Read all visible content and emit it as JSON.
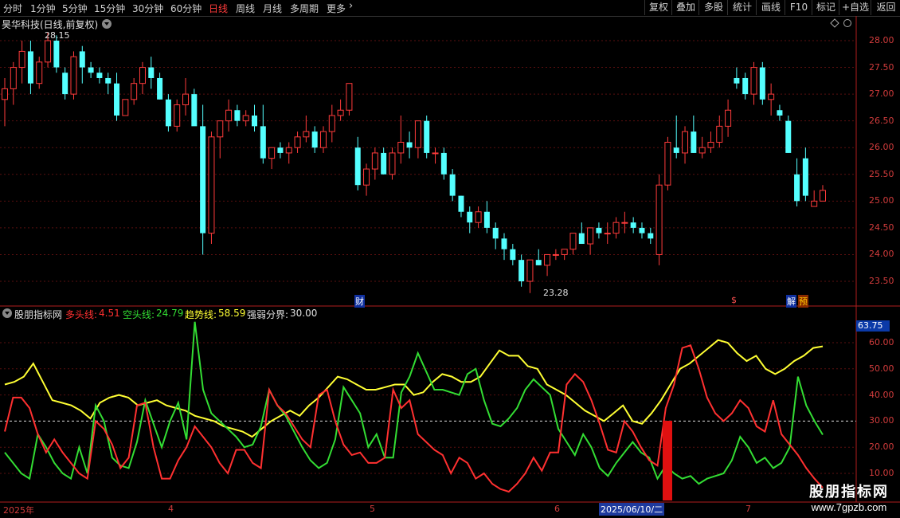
{
  "toolbar": {
    "periods": [
      "分时",
      "1分钟",
      "5分钟",
      "15分钟",
      "30分钟",
      "60分钟",
      "日线",
      "周线",
      "月线",
      "多周期",
      "更多"
    ],
    "active_period": "日线",
    "more_chevron": "›",
    "right_tools": [
      "复权",
      "叠加",
      "多股",
      "统计",
      "画线",
      "F10",
      "标记",
      "+自选",
      "返回"
    ]
  },
  "main_chart": {
    "stock_title": "昊华科技(日线,前复权)",
    "high_marker": "28.15",
    "low_marker": "23.28",
    "y_ticks": [
      "28.00",
      "27.50",
      "27.00",
      "26.50",
      "26.00",
      "25.50",
      "25.00",
      "24.50",
      "24.00",
      "23.50"
    ],
    "event_markers": [
      "财",
      "$",
      "解",
      "预"
    ]
  },
  "indicator": {
    "name": "股朋指标网",
    "lines": [
      {
        "label": "多头线:",
        "value": "4.51",
        "color": "#ff3030"
      },
      {
        "label": "空头线:",
        "value": "24.79",
        "color": "#33dd33"
      },
      {
        "label": "趋势线:",
        "value": "58.59",
        "color": "#ffff33"
      },
      {
        "label": "强弱分界:",
        "value": "30.00",
        "color": "#e0e0e0"
      }
    ],
    "current_value": "63.75",
    "y_ticks": [
      "60.00",
      "50.00",
      "40.00",
      "30.00",
      "20.00",
      "10.00"
    ]
  },
  "date_axis": {
    "labels": [
      "2025年",
      "4",
      "5",
      "6",
      "7"
    ],
    "cursor_date": "2025/06/10/二"
  },
  "watermark": {
    "title": "股朋指标网",
    "url": "www.7gpzb.com"
  },
  "colors": {
    "up": "#ff3b3b",
    "down": "#54ffff",
    "multi": "#ff3030",
    "empty": "#33dd33",
    "trend": "#ffff33",
    "axis": "#b01e1e"
  },
  "chart_data": {
    "type": "candlestick",
    "ohlc": [
      [
        26.9,
        27.3,
        26.4,
        27.1
      ],
      [
        27.1,
        27.6,
        26.8,
        27.5
      ],
      [
        27.5,
        28.0,
        27.2,
        27.8
      ],
      [
        27.8,
        28.0,
        27.0,
        27.2
      ],
      [
        27.2,
        27.7,
        27.1,
        27.6
      ],
      [
        27.6,
        28.15,
        27.5,
        28.0
      ],
      [
        28.0,
        28.1,
        27.4,
        27.5
      ],
      [
        27.4,
        27.5,
        26.9,
        27.0
      ],
      [
        27.0,
        27.8,
        26.9,
        27.7
      ],
      [
        27.8,
        27.9,
        27.2,
        27.5
      ],
      [
        27.5,
        27.6,
        27.3,
        27.4
      ],
      [
        27.4,
        27.5,
        27.2,
        27.3
      ],
      [
        27.3,
        27.4,
        27.0,
        27.2
      ],
      [
        27.2,
        27.4,
        26.5,
        26.6
      ],
      [
        26.6,
        26.9,
        26.6,
        26.9
      ],
      [
        26.9,
        27.3,
        26.8,
        27.2
      ],
      [
        27.2,
        27.6,
        27.0,
        27.5
      ],
      [
        27.5,
        27.7,
        27.1,
        27.3
      ],
      [
        27.3,
        27.4,
        26.9,
        26.9
      ],
      [
        26.9,
        27.0,
        26.3,
        26.4
      ],
      [
        26.4,
        26.9,
        26.3,
        26.8
      ],
      [
        26.8,
        27.3,
        26.6,
        27.0
      ],
      [
        27.0,
        27.1,
        26.5,
        26.4
      ],
      [
        26.4,
        26.8,
        24.0,
        24.4
      ],
      [
        24.4,
        26.3,
        24.2,
        26.2
      ],
      [
        26.2,
        26.5,
        25.8,
        26.5
      ],
      [
        26.5,
        26.9,
        26.3,
        26.7
      ],
      [
        26.7,
        26.8,
        26.4,
        26.5
      ],
      [
        26.5,
        26.7,
        26.4,
        26.6
      ],
      [
        26.6,
        26.8,
        26.3,
        26.4
      ],
      [
        26.4,
        26.8,
        25.7,
        25.8
      ],
      [
        25.8,
        26.0,
        25.6,
        26.0
      ],
      [
        26.0,
        26.1,
        25.8,
        25.9
      ],
      [
        25.9,
        26.1,
        25.7,
        26.0
      ],
      [
        26.0,
        26.3,
        25.9,
        26.2
      ],
      [
        26.2,
        26.6,
        26.1,
        26.3
      ],
      [
        26.3,
        26.4,
        25.9,
        26.0
      ],
      [
        26.0,
        26.4,
        25.9,
        26.3
      ],
      [
        26.3,
        26.8,
        26.1,
        26.6
      ],
      [
        26.6,
        26.9,
        26.5,
        26.7
      ],
      [
        26.7,
        27.1,
        26.6,
        27.2
      ],
      [
        26.0,
        26.2,
        25.2,
        25.3
      ],
      [
        25.3,
        25.7,
        25.1,
        25.6
      ],
      [
        25.6,
        26.0,
        25.4,
        25.9
      ],
      [
        25.9,
        26.0,
        25.5,
        25.5
      ],
      [
        25.5,
        26.0,
        25.4,
        25.9
      ],
      [
        25.9,
        26.6,
        25.7,
        26.1
      ],
      [
        26.1,
        26.3,
        25.8,
        26.0
      ],
      [
        26.0,
        26.5,
        25.8,
        26.5
      ],
      [
        26.5,
        26.6,
        25.8,
        25.9
      ],
      [
        25.9,
        26.0,
        25.7,
        25.9
      ],
      [
        25.9,
        26.0,
        25.4,
        25.5
      ],
      [
        25.5,
        25.6,
        25.0,
        25.1
      ],
      [
        25.1,
        25.1,
        24.7,
        24.8
      ],
      [
        24.8,
        24.9,
        24.4,
        24.6
      ],
      [
        24.6,
        24.9,
        24.5,
        24.8
      ],
      [
        24.8,
        25.0,
        24.4,
        24.5
      ],
      [
        24.5,
        24.6,
        24.1,
        24.3
      ],
      [
        24.3,
        24.4,
        23.9,
        24.1
      ],
      [
        24.1,
        24.2,
        23.8,
        23.9
      ],
      [
        23.9,
        24.0,
        23.4,
        23.5
      ],
      [
        23.5,
        23.9,
        23.28,
        23.9
      ],
      [
        23.9,
        24.1,
        23.8,
        23.8
      ],
      [
        23.8,
        24.0,
        23.6,
        24.0
      ],
      [
        24.0,
        24.1,
        23.9,
        24.0
      ],
      [
        24.0,
        24.1,
        23.9,
        24.1
      ],
      [
        24.1,
        24.4,
        24.0,
        24.4
      ],
      [
        24.4,
        24.6,
        24.2,
        24.2
      ],
      [
        24.2,
        24.5,
        24.0,
        24.5
      ],
      [
        24.5,
        24.6,
        24.3,
        24.4
      ],
      [
        24.4,
        24.6,
        24.2,
        24.4
      ],
      [
        24.4,
        24.7,
        24.3,
        24.6
      ],
      [
        24.6,
        24.8,
        24.4,
        24.6
      ],
      [
        24.6,
        24.7,
        24.4,
        24.5
      ],
      [
        24.5,
        24.6,
        24.3,
        24.4
      ],
      [
        24.4,
        24.5,
        24.2,
        24.3
      ],
      [
        24.0,
        25.5,
        23.8,
        25.3
      ],
      [
        25.3,
        26.2,
        25.2,
        26.1
      ],
      [
        26.0,
        26.6,
        25.8,
        25.9
      ],
      [
        25.9,
        26.4,
        25.7,
        26.3
      ],
      [
        26.3,
        26.6,
        25.9,
        25.9
      ],
      [
        25.9,
        26.2,
        25.8,
        26.0
      ],
      [
        26.0,
        26.3,
        25.9,
        26.1
      ],
      [
        26.1,
        26.6,
        26.0,
        26.4
      ],
      [
        26.4,
        26.9,
        26.2,
        26.7
      ],
      [
        27.3,
        27.5,
        27.1,
        27.2
      ],
      [
        27.3,
        27.4,
        26.9,
        27.0
      ],
      [
        27.0,
        27.6,
        26.8,
        27.5
      ],
      [
        27.5,
        27.6,
        26.8,
        26.9
      ],
      [
        26.9,
        27.2,
        26.6,
        27.0
      ],
      [
        26.7,
        26.8,
        26.5,
        26.6
      ],
      [
        26.5,
        26.6,
        25.9,
        25.9
      ],
      [
        25.5,
        25.8,
        24.9,
        25.0
      ],
      [
        25.8,
        26.0,
        25.0,
        25.1
      ],
      [
        24.9,
        25.2,
        24.9,
        25.0
      ],
      [
        25.0,
        25.3,
        25.0,
        25.2
      ]
    ],
    "indicator_series": {
      "multi": [
        26,
        39,
        39,
        35,
        25,
        18,
        23,
        18,
        14,
        10,
        8,
        30,
        27,
        21,
        12,
        16,
        36,
        37,
        20,
        8,
        8,
        15,
        20,
        28,
        24,
        20,
        14,
        10,
        19,
        19,
        14,
        12,
        42,
        36,
        33,
        28,
        23,
        20,
        40,
        42,
        30,
        21,
        17,
        18,
        14,
        14,
        16,
        42,
        35,
        38,
        25,
        22,
        19,
        17,
        10,
        16,
        14,
        8,
        10,
        6,
        4,
        3,
        6,
        10,
        16,
        11,
        18,
        18,
        44,
        48,
        45,
        38,
        29,
        19,
        18,
        30,
        26,
        20,
        15,
        13,
        35,
        44,
        58,
        59,
        50,
        39,
        33,
        30,
        33,
        38,
        35,
        28,
        26,
        38,
        25,
        21,
        17,
        12,
        8,
        4.51
      ],
      "empty": [
        18,
        14,
        10,
        8,
        25,
        20,
        14,
        10,
        8,
        20,
        10,
        36,
        30,
        16,
        13,
        12,
        22,
        38,
        29,
        20,
        30,
        37,
        23,
        68,
        42,
        33,
        30,
        27,
        24,
        20,
        21,
        28,
        42,
        36,
        32,
        26,
        20,
        15,
        12,
        14,
        23,
        43,
        38,
        33,
        20,
        25,
        16,
        16,
        41,
        47,
        56,
        49,
        42,
        42,
        41,
        40,
        48,
        50,
        38,
        29,
        28,
        31,
        35,
        42,
        46,
        43,
        40,
        27,
        22,
        17,
        25,
        20,
        12,
        9,
        14,
        18,
        22,
        18,
        16,
        8,
        13,
        10,
        8,
        9,
        6,
        8,
        9,
        10,
        15,
        24,
        20,
        14,
        16,
        12,
        14,
        20,
        47,
        36,
        30,
        24.79
      ],
      "trend": [
        44,
        45,
        47,
        52,
        45,
        38,
        37,
        36,
        34,
        31,
        37,
        39,
        40,
        39,
        36,
        37,
        38,
        36,
        35,
        34,
        32,
        31,
        30,
        28,
        27,
        26,
        24,
        27,
        30,
        32,
        34,
        32,
        36,
        39,
        43,
        47,
        46,
        44,
        42,
        42,
        43,
        44,
        44,
        40,
        41,
        45,
        48,
        47,
        45,
        45,
        47,
        52,
        57,
        55,
        55,
        51,
        50,
        44,
        42,
        40,
        37,
        34,
        32,
        30,
        33,
        36,
        30,
        29,
        33,
        38,
        44,
        50,
        52,
        55,
        58,
        61,
        60,
        56,
        53,
        55,
        50,
        48,
        50,
        53,
        55,
        58,
        58.59
      ],
      "boundary": 30
    }
  }
}
